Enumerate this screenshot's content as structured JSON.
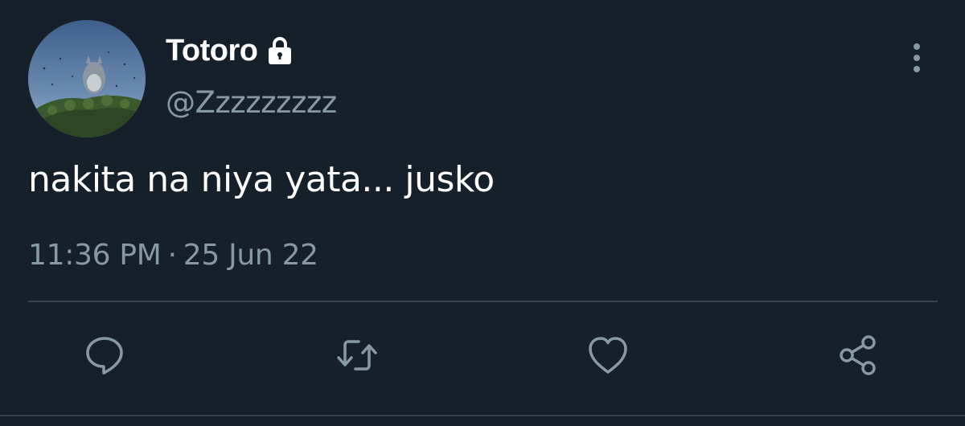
{
  "tweet": {
    "display_name": "Totoro",
    "handle": "@Zzzzzzzzz",
    "text": "nakita na niya yata... jusko",
    "time": "11:36 PM",
    "separator": "·",
    "date": "25 Jun 22",
    "protected": true
  },
  "icons": {
    "lock": "lock-icon",
    "more": "more-vertical-icon",
    "reply": "reply-icon",
    "retweet": "retweet-icon",
    "like": "heart-icon",
    "share": "share-icon"
  },
  "colors": {
    "background": "#15202b",
    "primary_text": "#ffffff",
    "secondary_text": "#8899a6",
    "divider": "#38444d"
  }
}
